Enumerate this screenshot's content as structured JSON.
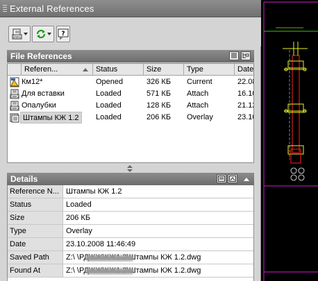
{
  "palette": {
    "title": "External References"
  },
  "toolbar": {
    "attach_icon": "attach-dwg-icon",
    "refresh_icon": "refresh-icon",
    "help_icon": "help-icon"
  },
  "file_references": {
    "title": "File References",
    "columns": [
      "Referen...",
      "Status",
      "Size",
      "Type",
      "Date"
    ],
    "rows": [
      {
        "name": "Км12*",
        "status": "Opened",
        "size": "326 КБ",
        "type": "Current",
        "date": "22.08.",
        "icon": "current-drawing-icon"
      },
      {
        "name": "Для вставки",
        "status": "Loaded",
        "size": "571 КБ",
        "type": "Attach",
        "date": "16.10.",
        "icon": "dwg-file-icon"
      },
      {
        "name": "Опалубки",
        "status": "Loaded",
        "size": "128 КБ",
        "type": "Attach",
        "date": "21.12.",
        "icon": "dwg-file-icon"
      },
      {
        "name": "Штампы КЖ 1.2",
        "status": "Loaded",
        "size": "206 КБ",
        "type": "Overlay",
        "date": "23.10.",
        "icon": "overlay-file-icon"
      }
    ]
  },
  "details": {
    "title": "Details",
    "rows": [
      {
        "key": "Reference N...",
        "value": "Штампы КЖ 1.2"
      },
      {
        "key": "Status",
        "value": "Loaded"
      },
      {
        "key": "Size",
        "value": "206 КБ"
      },
      {
        "key": "Type",
        "value": "Overlay"
      },
      {
        "key": "Date",
        "value": "23.10.2008 11:46:49"
      },
      {
        "key": "Saved Path",
        "value": "Z:\\            \\РД\\КЖ\\КЖ1.2\\Штампы КЖ 1.2.dwg"
      },
      {
        "key": "Found At",
        "value": "Z:\\            \\РД\\КЖ\\КЖ1.2\\Штампы КЖ 1.2.dwg"
      }
    ]
  },
  "colors": {
    "title_bar": "#7a7a7a",
    "drawing_background": "#000000",
    "drawing_lines": "#f0f020",
    "drawing_accent": "#ff2020",
    "drawing_green": "#20d020",
    "drawing_magenta": "#d020d0"
  }
}
